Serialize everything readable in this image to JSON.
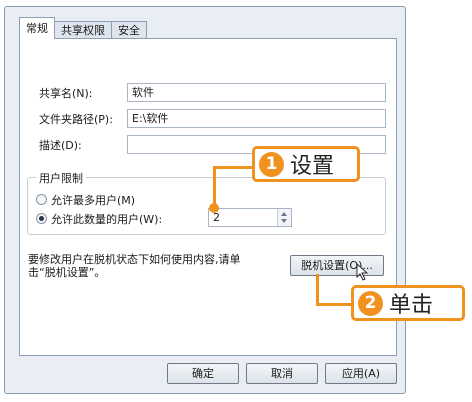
{
  "tabs": [
    "常规",
    "共享权限",
    "安全"
  ],
  "share_name": {
    "label": "共享名(N):",
    "value": "软件"
  },
  "folder_path": {
    "label": "文件夹路径(P):",
    "value": "E:\\软件"
  },
  "description": {
    "label": "描述(D):",
    "value": ""
  },
  "user_limit": {
    "legend": "用户限制",
    "option_max": "允许最多用户(M)",
    "option_count": "允许此数量的用户(W):",
    "count_value": "2",
    "selected": "option_count"
  },
  "offline": {
    "note_line1": "要修改用户在脱机状态下如何使用内容,请单",
    "note_line2": "击“脱机设置”。",
    "button": "脱机设置(O)..."
  },
  "footer": {
    "ok": "确定",
    "cancel": "取消",
    "apply": "应用(A)"
  },
  "annotations": {
    "step1_number": "1",
    "step1_text": "设置",
    "step2_number": "2",
    "step2_text": "单击",
    "accent_color": "#f0921e"
  }
}
